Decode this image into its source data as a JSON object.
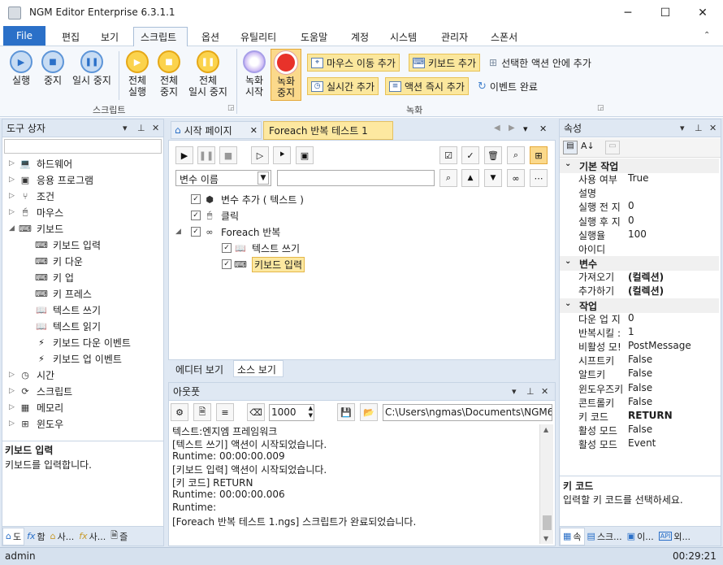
{
  "window": {
    "app_name": "NGM Editor",
    "edition": "Enterprise 6.3.1.1",
    "controls": {
      "minimize": "─",
      "maximize": "☐",
      "close": "✕"
    }
  },
  "menu": {
    "file": "File",
    "items": [
      "편집",
      "보기",
      "스크립트",
      "옵션",
      "유틸리티",
      "도움말",
      "계정",
      "시스템",
      "관리자",
      "스폰서"
    ],
    "active": "스크립트"
  },
  "ribbon": {
    "script_group": {
      "label": "스크립트",
      "buttons": [
        {
          "line1": "실행",
          "line2": ""
        },
        {
          "line1": "중지",
          "line2": ""
        },
        {
          "line1": "일시 중지",
          "line2": ""
        },
        {
          "line1": "전체",
          "line2": "실행"
        },
        {
          "line1": "전체",
          "line2": "중지"
        },
        {
          "line1": "전체",
          "line2": "일시 중지"
        }
      ]
    },
    "record_group": {
      "label": "녹화",
      "record_start": {
        "line1": "녹화",
        "line2": "시작"
      },
      "record_stop": {
        "line1": "녹화",
        "line2": "중지"
      },
      "mouse_move": "마우스 이동 추가",
      "keyboard_add": "키보드 추가",
      "add_in_action": "선택한 액션 안에 추가",
      "realtime_add": "실시간 추가",
      "action_now_add": "액션 즉시 추가",
      "event_done": "이벤트 완료"
    }
  },
  "toolbox": {
    "title": "도구 상자",
    "items": [
      {
        "label": "하드웨어",
        "icon": "laptop-icon",
        "level": 0,
        "arrow": "▷"
      },
      {
        "label": "응용 프로그램",
        "icon": "console-icon",
        "level": 0,
        "arrow": "▷"
      },
      {
        "label": "조건",
        "icon": "branch-icon",
        "level": 0,
        "arrow": "▷"
      },
      {
        "label": "마우스",
        "icon": "mouse-icon",
        "level": 0,
        "arrow": "▷"
      },
      {
        "label": "키보드",
        "icon": "keyboard-icon",
        "level": 0,
        "arrow": "◢"
      },
      {
        "label": "키보드 입력",
        "icon": "keyboard-icon",
        "level": 1,
        "arrow": ""
      },
      {
        "label": "키 다운",
        "icon": "key-down-icon",
        "level": 1,
        "arrow": ""
      },
      {
        "label": "키 업",
        "icon": "key-up-icon",
        "level": 1,
        "arrow": ""
      },
      {
        "label": "키 프레스",
        "icon": "key-press-icon",
        "level": 1,
        "arrow": ""
      },
      {
        "label": "텍스트 쓰기",
        "icon": "book-icon",
        "level": 1,
        "arrow": ""
      },
      {
        "label": "텍스트 읽기",
        "icon": "book-open-icon",
        "level": 1,
        "arrow": ""
      },
      {
        "label": "키보드 다운 이벤트",
        "icon": "lightning-icon",
        "level": 1,
        "arrow": ""
      },
      {
        "label": "키보드 업 이벤트",
        "icon": "lightning-icon",
        "level": 1,
        "arrow": ""
      },
      {
        "label": "시간",
        "icon": "clock-icon",
        "level": 0,
        "arrow": "▷"
      },
      {
        "label": "스크립트",
        "icon": "script-icon",
        "level": 0,
        "arrow": "▷"
      },
      {
        "label": "메모리",
        "icon": "memory-icon",
        "level": 0,
        "arrow": "▷"
      },
      {
        "label": "윈도우",
        "icon": "windows-icon",
        "level": 0,
        "arrow": "▷"
      }
    ],
    "desc_title": "키보드 입력",
    "desc_text": "키보드를 입력합니다.",
    "bottom_tabs": [
      "도",
      "함",
      "사...",
      "사...",
      "즐"
    ]
  },
  "editor": {
    "tabs": [
      {
        "label": "시작 페이지",
        "active": false
      },
      {
        "label": "Foreach 반복 테스트 1",
        "active": true
      }
    ],
    "filter_select": "변수 이름",
    "filter_input": "",
    "tree": [
      {
        "label": "변수 추가 ( 텍스트 )",
        "icon": "cube-icon",
        "level": 0,
        "arrow": ""
      },
      {
        "label": "클릭",
        "icon": "mouse-icon",
        "level": 0,
        "arrow": ""
      },
      {
        "label": "Foreach 반복",
        "icon": "infinity-icon",
        "level": 0,
        "arrow": "◢"
      },
      {
        "label": "텍스트 쓰기",
        "icon": "book-icon",
        "level": 1,
        "arrow": ""
      },
      {
        "label": "키보드 입력",
        "icon": "keyboard-icon",
        "level": 1,
        "arrow": "",
        "selected": true
      }
    ],
    "bottom_tabs": [
      "에디터 보기",
      "소스 보기"
    ]
  },
  "output": {
    "title": "아웃풋",
    "count": "1000",
    "path": "C:\\Users\\ngmas\\Documents\\NGM6\\",
    "lines": [
      "텍스트:엔지엠 프레임워크",
      "[텍스트 쓰기] 액션이 시작되었습니다.",
      "Runtime: 00:00:00.009",
      "[키보드 입력] 액션이 시작되었습니다.",
      "[키 코드] RETURN",
      "Runtime: 00:00:00.006",
      "Runtime:",
      "[Foreach 반복 테스트 1.ngs] 스크립트가 완료되었습니다."
    ]
  },
  "properties": {
    "title": "속성",
    "categories": [
      {
        "name": "기본 작업",
        "rows": [
          {
            "name": "사용 여부",
            "value": "True",
            "bold": false
          },
          {
            "name": "설명",
            "value": "",
            "bold": false
          },
          {
            "name": "실행 전 지",
            "value": "0",
            "bold": false
          },
          {
            "name": "실행 후 지",
            "value": "0",
            "bold": false
          },
          {
            "name": "실행율",
            "value": "100",
            "bold": false
          },
          {
            "name": "아이디",
            "value": "",
            "bold": false
          }
        ]
      },
      {
        "name": "변수",
        "rows": [
          {
            "name": "가져오기",
            "value": "(컬렉션)",
            "bold": true
          },
          {
            "name": "추가하기",
            "value": "(컬렉션)",
            "bold": true
          }
        ]
      },
      {
        "name": "작업",
        "rows": [
          {
            "name": "다운 업 지",
            "value": "0",
            "bold": false
          },
          {
            "name": "반복시킬 :",
            "value": "1",
            "bold": false
          },
          {
            "name": "비활성 모!",
            "value": "PostMessage",
            "bold": false
          },
          {
            "name": "시프트키",
            "value": "False",
            "bold": false
          },
          {
            "name": "알트키",
            "value": "False",
            "bold": false
          },
          {
            "name": "윈도우즈키",
            "value": "False",
            "bold": false
          },
          {
            "name": "콘트롤키",
            "value": "False",
            "bold": false
          },
          {
            "name": "키 코드",
            "value": "RETURN",
            "bold": true
          },
          {
            "name": "활성 모드",
            "value": "False",
            "bold": false
          },
          {
            "name": "활성 모드",
            "value": "Event",
            "bold": false
          }
        ]
      }
    ],
    "desc_title": "키 코드",
    "desc_text": "입력할 키 코드를 선택하세요.",
    "bottom_tabs": [
      "속",
      "스크...",
      "이...",
      "외..."
    ]
  },
  "status": {
    "user": "admin",
    "time": "00:29:21"
  },
  "colors": {
    "accent": "#2b70c8",
    "selected_bg": "#fde8a0",
    "panel_header": "#dfe8f3",
    "status_bar": "#d6e1ee"
  }
}
